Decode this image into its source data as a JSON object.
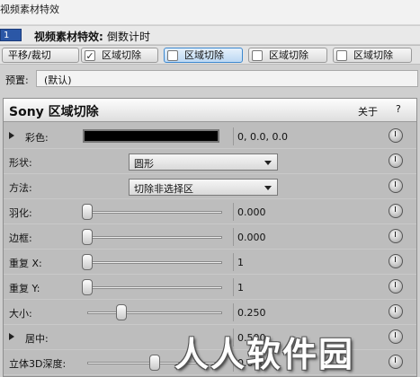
{
  "window": {
    "title": "视频素材特效"
  },
  "chain": {
    "number": "1",
    "title_prefix": "视频素材特效:",
    "title_name": "倒数计时"
  },
  "tabs": [
    {
      "label": "平移/裁切",
      "checked": false,
      "active": false
    },
    {
      "label": "区域切除",
      "checked": true,
      "active": false
    },
    {
      "label": "区域切除",
      "checked": false,
      "active": true
    },
    {
      "label": "区域切除",
      "checked": false,
      "active": false
    },
    {
      "label": "区域切除",
      "checked": false,
      "active": false
    }
  ],
  "preset": {
    "label": "预置:",
    "value": "(默认)"
  },
  "panel": {
    "title": "Sony 区域切除",
    "about": "关于",
    "help": "?",
    "params": {
      "color": {
        "label": "彩色:",
        "value": "0, 0.0, 0.0",
        "swatch": "#000000"
      },
      "shape": {
        "label": "形状:",
        "value": "圆形"
      },
      "method": {
        "label": "方法:",
        "value": "切除非选择区"
      },
      "feather": {
        "label": "羽化:",
        "value": "0.000",
        "level": 0.0
      },
      "border": {
        "label": "边框:",
        "value": "0.000",
        "level": 0.0
      },
      "repeat_x": {
        "label": "重复 X:",
        "value": "1",
        "level": 0.0
      },
      "repeat_y": {
        "label": "重复 Y:",
        "value": "1",
        "level": 0.0
      },
      "size": {
        "label": "大小:",
        "value": "0.250",
        "level": 0.25
      },
      "center": {
        "label": "居中:",
        "value": "0.500"
      },
      "stereo": {
        "label": "立体3D深度:",
        "value": "0.000",
        "level": 0.5
      }
    }
  },
  "watermark": {
    "text": "人人软件园"
  }
}
